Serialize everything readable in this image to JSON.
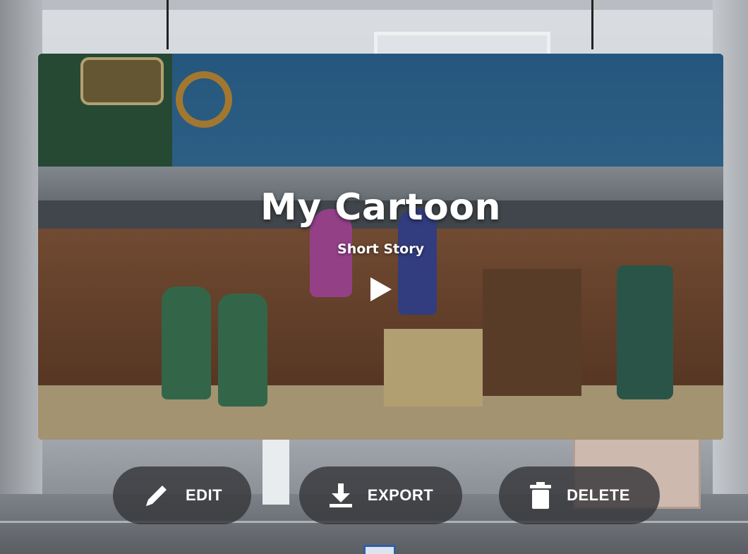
{
  "project": {
    "title": "My Cartoon",
    "subtitle": "Short Story"
  },
  "actions": {
    "edit_label": "EDIT",
    "export_label": "EXPORT",
    "delete_label": "DELETE"
  },
  "icons": {
    "play": "play-icon",
    "edit": "pencil-icon",
    "export": "download-icon",
    "delete": "trash-icon"
  },
  "colors": {
    "button_background": "#37373a",
    "text": "#ffffff"
  }
}
